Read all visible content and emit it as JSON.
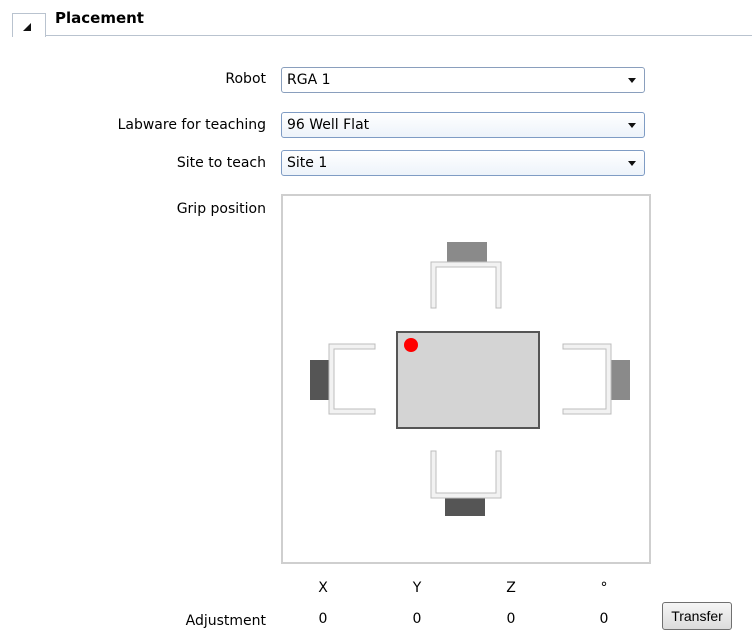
{
  "section": {
    "title": "Placement"
  },
  "form": {
    "robot_label": "Robot",
    "robot_value": "RGA 1",
    "labware_label": "Labware for teaching",
    "labware_value": "96 Well Flat",
    "site_label": "Site to teach",
    "site_value": "Site 1",
    "grip_label": "Grip position"
  },
  "grip": {
    "selected_marker_color": "#ff0000"
  },
  "adjustment": {
    "label": "Adjustment",
    "headers": [
      "X",
      "Y",
      "Z",
      "°"
    ],
    "values": [
      "0",
      "0",
      "0",
      "0"
    ]
  },
  "buttons": {
    "transfer": "Transfer"
  },
  "icons": {
    "collapse": "collapse-triangle-icon",
    "dropdown": "dropdown-arrow-icon"
  }
}
